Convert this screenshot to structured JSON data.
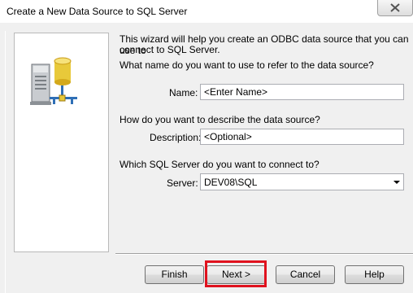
{
  "window": {
    "title": "Create a New Data Source to SQL Server"
  },
  "intro": {
    "line1": "This wizard will help you create an ODBC data source that you can use to",
    "line2": "connect to SQL Server."
  },
  "name_section": {
    "question": "What name do you want to use to refer to the data source?",
    "label": "Name:",
    "value": "<Enter Name>"
  },
  "description_section": {
    "question": "How do you want to describe the data source?",
    "label": "Description:",
    "value": "<Optional>"
  },
  "server_section": {
    "question": "Which SQL Server do you want to connect to?",
    "label": "Server:",
    "value": "DEV08\\SQL"
  },
  "buttons": {
    "finish": "Finish",
    "next": "Next >",
    "cancel": "Cancel",
    "help": "Help"
  },
  "icons": {
    "close": "close-icon",
    "illustration": "database-server-icon"
  },
  "colors": {
    "highlight": "#e0121e",
    "dialog_bg": "#f0f0f0"
  }
}
